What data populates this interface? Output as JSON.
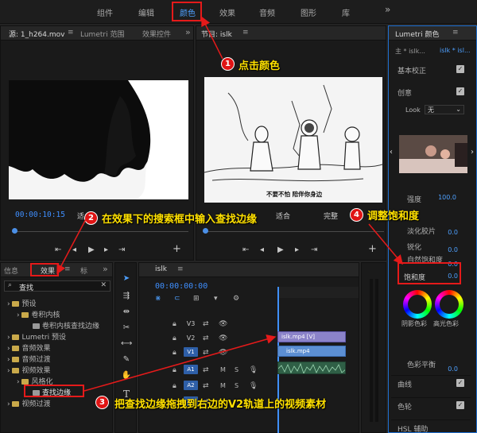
{
  "workspaces": {
    "items": [
      "组件",
      "编辑",
      "颜色",
      "效果",
      "音频",
      "图形",
      "库"
    ],
    "active_index": 2,
    "more": "»"
  },
  "source_monitor": {
    "tabs": [
      "源: 1_h264.mov",
      "Lumetri 范围",
      "效果控件"
    ],
    "timecode": "00:00:10:15",
    "fit_label": "适"
  },
  "program_monitor": {
    "title": "节目: islk",
    "fit_label": "适合",
    "full_label": "完整",
    "subtitle_text": "不要不怕  陪伴你身边"
  },
  "lumetri": {
    "title": "Lumetri 颜色",
    "clip_tabs": [
      "主 * islk...",
      "islk * isl..."
    ],
    "basic_correction": "基本校正",
    "creative": "创意",
    "look_label": "Look",
    "look_value": "无",
    "intensity_label": "强度",
    "intensity_value": "100.0",
    "faded_film_label": "淡化胶片",
    "faded_film_value": "0.0",
    "sharpen_label": "锐化",
    "sharpen_value": "0.0",
    "vibrance_label": "自然饱和度",
    "vibrance_value": "0.0",
    "saturation_label": "饱和度",
    "saturation_value": "0.0",
    "shadow_tint_label": "阴影色彩",
    "highlight_tint_label": "高光色彩",
    "tint_balance_label": "色彩平衡",
    "tint_balance_value": "0.0",
    "curves": "曲线",
    "color_wheels": "色轮",
    "hsl": "HSL 辅助"
  },
  "effects_panel": {
    "tabs": [
      "信息",
      "效果",
      "标"
    ],
    "search_value": "查找",
    "tree": [
      {
        "label": "预设",
        "level": 0,
        "type": "folder"
      },
      {
        "label": "卷积内核",
        "level": 1,
        "type": "folder"
      },
      {
        "label": "卷积内核查找边缘",
        "level": 2,
        "type": "preset"
      },
      {
        "label": "Lumetri 预设",
        "level": 0,
        "type": "folder"
      },
      {
        "label": "音频效果",
        "level": 0,
        "type": "folder"
      },
      {
        "label": "音频过渡",
        "level": 0,
        "type": "folder"
      },
      {
        "label": "视频效果",
        "level": 0,
        "type": "folder"
      },
      {
        "label": "风格化",
        "level": 1,
        "type": "folder"
      },
      {
        "label": "查找边缘",
        "level": 2,
        "type": "effect"
      },
      {
        "label": "视频过渡",
        "level": 0,
        "type": "folder"
      }
    ]
  },
  "timeline": {
    "sequence_name": "islk",
    "timecode": "00:00:00:00",
    "tracks": [
      {
        "name": "V3",
        "kind": "video"
      },
      {
        "name": "V2",
        "kind": "video"
      },
      {
        "name": "V1",
        "kind": "video"
      },
      {
        "name": "A1",
        "kind": "audio"
      },
      {
        "name": "A2",
        "kind": "audio"
      },
      {
        "name": "A3",
        "kind": "audio"
      }
    ],
    "clip_v2": "islk.mp4 [V]",
    "clip_v1": "islk.mp4",
    "track_m": "M",
    "track_s": "S"
  },
  "annotations": [
    {
      "number": "1",
      "text": "点击颜色"
    },
    {
      "number": "2",
      "text": "在效果下的搜索框中输入查找边缘"
    },
    {
      "number": "3",
      "text": "把查找边缘拖拽到右边的V2轨道上的视频素材"
    },
    {
      "number": "4",
      "text": "调整饱和度"
    }
  ],
  "colors": {
    "accent": "#3f8fff",
    "annotation_red": "#e51a1a",
    "annotation_text": "#ffe000",
    "folder": "#c9a94a",
    "panel_bg": "#1a1a1a"
  }
}
